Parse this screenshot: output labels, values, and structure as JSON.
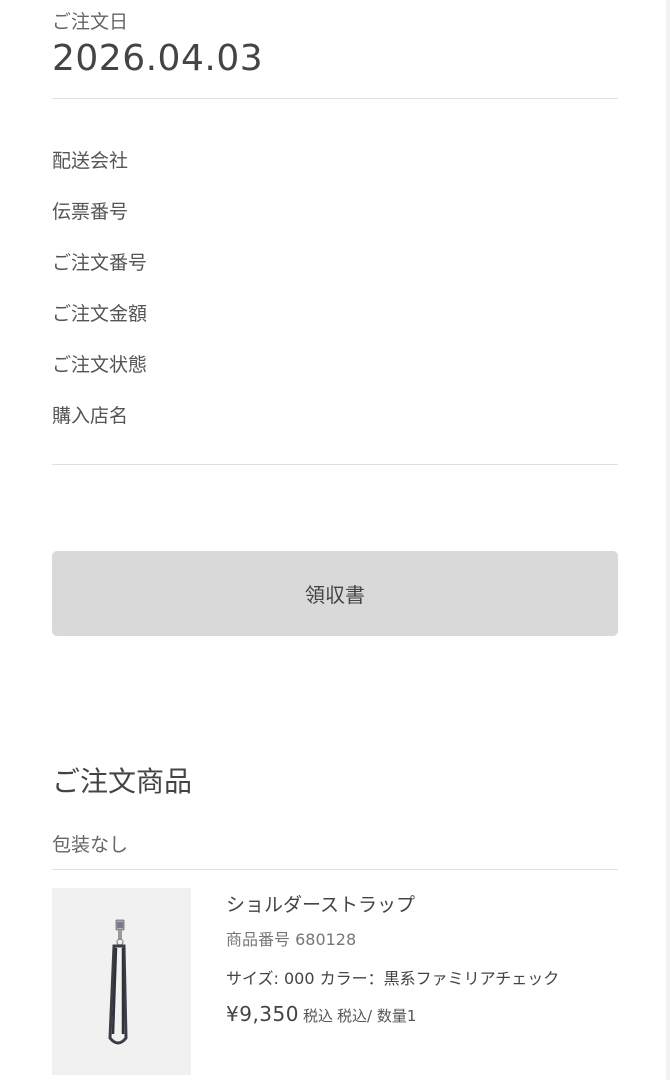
{
  "order": {
    "date_label": "ご注文日",
    "date_value": "2026.04.03"
  },
  "details": [
    {
      "label": "配送会社"
    },
    {
      "label": "伝票番号"
    },
    {
      "label": "ご注文番号"
    },
    {
      "label": "ご注文金額"
    },
    {
      "label": "ご注文状態"
    },
    {
      "label": "購入店名"
    }
  ],
  "receipt": {
    "button_label": "領収書"
  },
  "items_section": {
    "title": "ご注文商品",
    "wrapping": "包装なし",
    "product": {
      "name": "ショルダーストラップ",
      "number": "商品番号 680128",
      "variant": "サイズ: 000 カラー：黒系ファミリアチェック",
      "price": "¥9,350",
      "tax_label": "税込",
      "tax_quantity": "税込/ 数量1",
      "image_icon": "strap-product-image"
    }
  },
  "colors": {
    "button_bg": "#d9d9d9",
    "divider": "#e0e0e0",
    "image_bg": "#f1f1f1"
  }
}
